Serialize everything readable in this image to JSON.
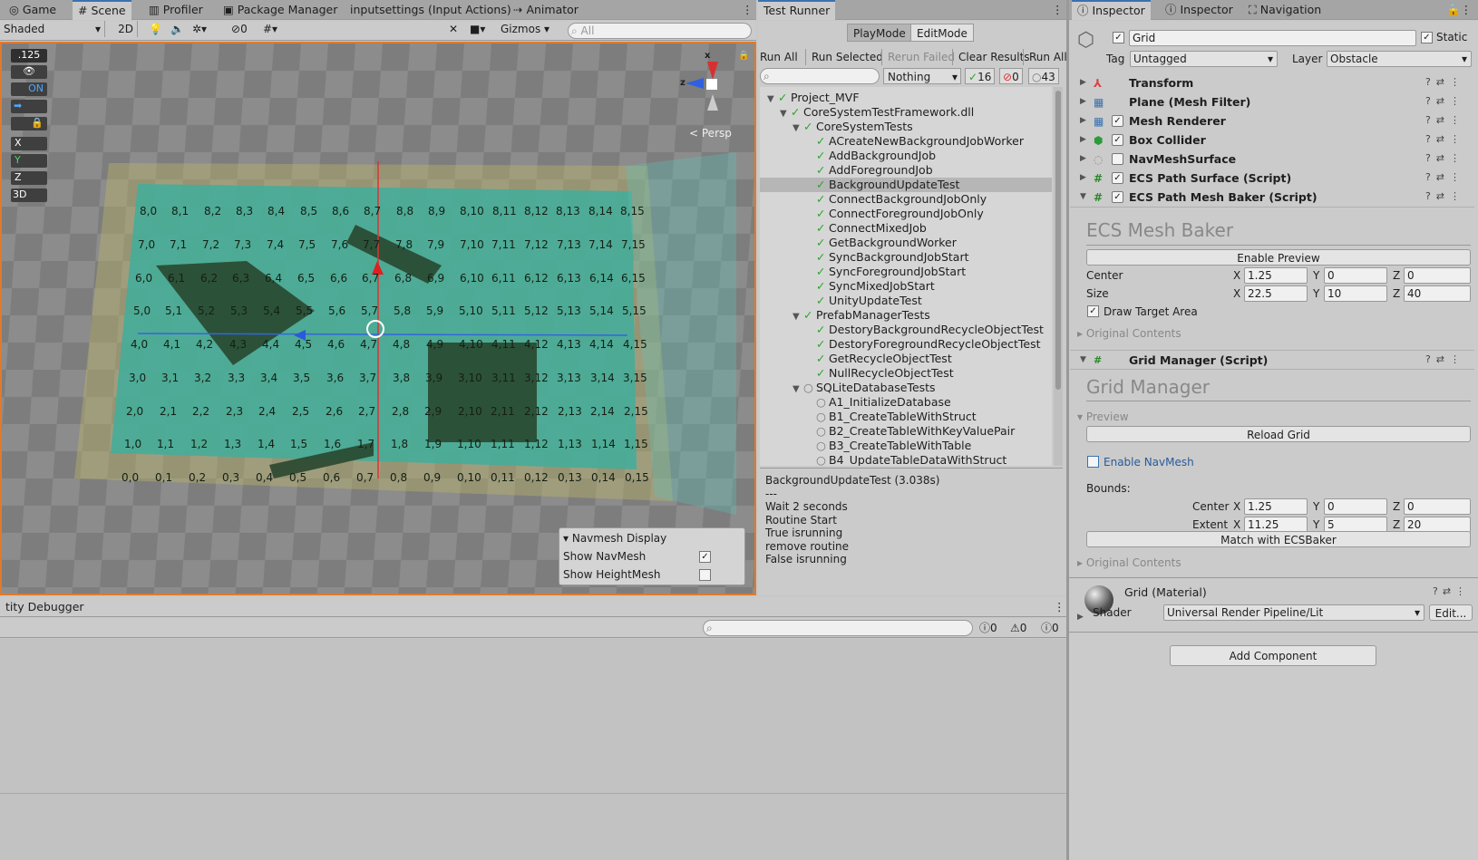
{
  "scene_tabs": {
    "game": "Game",
    "scene": "Scene",
    "profiler": "Profiler",
    "package_manager": "Package Manager",
    "input_settings": "inputsettings (Input Actions)",
    "animator": "Animator"
  },
  "scene_toolbar": {
    "shading": "Shaded",
    "mode_2d": "2D",
    "hidden_count": "0",
    "gizmos": "Gizmos",
    "search_placeholder": "All"
  },
  "scene_overlay": {
    "snap_value": ".125",
    "toggle_on": "ON",
    "axis_x": "X",
    "axis_y": "Y",
    "axis_z": "Z",
    "axis_3d": "3D",
    "persp": "Persp",
    "gizmo_x": "x",
    "gizmo_z": "z"
  },
  "navmesh_display": {
    "title": "Navmesh Display",
    "show_navmesh": "Show NavMesh",
    "show_heightmesh": "Show HeightMesh",
    "show_navmesh_checked": true,
    "show_heightmesh_checked": false
  },
  "grid_labels": [
    [
      "8,0",
      "8,1",
      "8,2",
      "8,3",
      "8,4",
      "8,5",
      "8,6",
      "8,7",
      "8,8",
      "8,9",
      "8,10",
      "8,11",
      "8,12",
      "8,13",
      "8,14",
      "8,15"
    ],
    [
      "7,0",
      "7,1",
      "7,2",
      "7,3",
      "7,4",
      "7,5",
      "7,6",
      "7,7",
      "7,8",
      "7,9",
      "7,10",
      "7,11",
      "7,12",
      "7,13",
      "7,14",
      "7,15"
    ],
    [
      "6,0",
      "6,1",
      "6,2",
      "6,3",
      "6,4",
      "6,5",
      "6,6",
      "6,7",
      "6,8",
      "6,9",
      "6,10",
      "6,11",
      "6,12",
      "6,13",
      "6,14",
      "6,15"
    ],
    [
      "5,0",
      "5,1",
      "5,2",
      "5,3",
      "5,4",
      "5,5",
      "5,6",
      "5,7",
      "5,8",
      "5,9",
      "5,10",
      "5,11",
      "5,12",
      "5,13",
      "5,14",
      "5,15"
    ],
    [
      "4,0",
      "4,1",
      "4,2",
      "4,3",
      "4,4",
      "4,5",
      "4,6",
      "4,7",
      "4,8",
      "4,9",
      "4,10",
      "4,11",
      "4,12",
      "4,13",
      "4,14",
      "4,15"
    ],
    [
      "3,0",
      "3,1",
      "3,2",
      "3,3",
      "3,4",
      "3,5",
      "3,6",
      "3,7",
      "3,8",
      "3,9",
      "3,10",
      "3,11",
      "3,12",
      "3,13",
      "3,14",
      "3,15"
    ],
    [
      "2,0",
      "2,1",
      "2,2",
      "2,3",
      "2,4",
      "2,5",
      "2,6",
      "2,7",
      "2,8",
      "2,9",
      "2,10",
      "2,11",
      "2,12",
      "2,13",
      "2,14",
      "2,15"
    ],
    [
      "1,0",
      "1,1",
      "1,2",
      "1,3",
      "1,4",
      "1,5",
      "1,6",
      "1,7",
      "1,8",
      "1,9",
      "1,10",
      "1,11",
      "1,12",
      "1,13",
      "1,14",
      "1,15"
    ],
    [
      "0,0",
      "0,1",
      "0,2",
      "0,3",
      "0,4",
      "0,5",
      "0,6",
      "0,7",
      "0,8",
      "0,9",
      "0,10",
      "0,11",
      "0,12",
      "0,13",
      "0,14",
      "0,15"
    ]
  ],
  "test_runner": {
    "tab": "Test Runner",
    "playmode": "PlayMode",
    "editmode": "EditMode",
    "run_all": "Run All",
    "run_selected": "Run Selected",
    "rerun_failed": "Rerun Failed",
    "clear_results": "Clear Results",
    "run_all_2": "Run All",
    "filter": "Nothing",
    "passed": "16",
    "failed": "0",
    "not_run": "43",
    "tree": [
      {
        "label": "Project_MVF",
        "depth": 0,
        "status": "pass",
        "expanded": true
      },
      {
        "label": "CoreSystemTestFramework.dll",
        "depth": 1,
        "status": "pass",
        "expanded": true
      },
      {
        "label": "CoreSystemTests",
        "depth": 2,
        "status": "pass",
        "expanded": true
      },
      {
        "label": "ACreateNewBackgroundJobWorker",
        "depth": 3,
        "status": "pass"
      },
      {
        "label": "AddBackgroundJob",
        "depth": 3,
        "status": "pass"
      },
      {
        "label": "AddForegroundJob",
        "depth": 3,
        "status": "pass"
      },
      {
        "label": "BackgroundUpdateTest",
        "depth": 3,
        "status": "pass",
        "selected": true
      },
      {
        "label": "ConnectBackgroundJobOnly",
        "depth": 3,
        "status": "pass"
      },
      {
        "label": "ConnectForegroundJobOnly",
        "depth": 3,
        "status": "pass"
      },
      {
        "label": "ConnectMixedJob",
        "depth": 3,
        "status": "pass"
      },
      {
        "label": "GetBackgroundWorker",
        "depth": 3,
        "status": "pass"
      },
      {
        "label": "SyncBackgroundJobStart",
        "depth": 3,
        "status": "pass"
      },
      {
        "label": "SyncForegroundJobStart",
        "depth": 3,
        "status": "pass"
      },
      {
        "label": "SyncMixedJobStart",
        "depth": 3,
        "status": "pass"
      },
      {
        "label": "UnityUpdateTest",
        "depth": 3,
        "status": "pass"
      },
      {
        "label": "PrefabManagerTests",
        "depth": 2,
        "status": "pass",
        "expanded": true
      },
      {
        "label": "DestoryBackgroundRecycleObjectTest",
        "depth": 3,
        "status": "pass"
      },
      {
        "label": "DestoryForegroundRecycleObjectTest",
        "depth": 3,
        "status": "pass"
      },
      {
        "label": "GetRecycleObjectTest",
        "depth": 3,
        "status": "pass"
      },
      {
        "label": "NullRecycleObjectTest",
        "depth": 3,
        "status": "pass"
      },
      {
        "label": "SQLiteDatabaseTests",
        "depth": 2,
        "status": "none",
        "expanded": true
      },
      {
        "label": "A1_InitializeDatabase",
        "depth": 3,
        "status": "none"
      },
      {
        "label": "B1_CreateTableWithStruct",
        "depth": 3,
        "status": "none"
      },
      {
        "label": "B2_CreateTableWithKeyValuePair",
        "depth": 3,
        "status": "none"
      },
      {
        "label": "B3_CreateTableWithTable",
        "depth": 3,
        "status": "none"
      },
      {
        "label": "B4_UpdateTableDataWithStruct",
        "depth": 3,
        "status": "none"
      }
    ],
    "output": [
      "BackgroundUpdateTest (3.038s)",
      "---",
      "Wait 2 seconds",
      "Routine Start",
      "True isrunning",
      "remove routine",
      "False isrunning"
    ]
  },
  "debugger": {
    "title": "tity Debugger",
    "log_count": "0",
    "warn_count": "0",
    "error_count": "0"
  },
  "inspector": {
    "tabs": {
      "inspector1": "Inspector",
      "inspector2": "Inspector",
      "navigation": "Navigation"
    },
    "object_name": "Grid",
    "static_label": "Static",
    "tag_label": "Tag",
    "tag_value": "Untagged",
    "layer_label": "Layer",
    "layer_value": "Obstacle",
    "components": [
      {
        "name": "Transform",
        "has_check": false,
        "icon": "transform-icon"
      },
      {
        "name": "Plane (Mesh Filter)",
        "has_check": false,
        "icon": "mesh-filter-icon"
      },
      {
        "name": "Mesh Renderer",
        "has_check": true,
        "icon": "mesh-renderer-icon"
      },
      {
        "name": "Box Collider",
        "has_check": true,
        "icon": "box-collider-icon"
      },
      {
        "name": "NavMeshSurface",
        "has_check": true,
        "icon": "navmesh-icon"
      },
      {
        "name": "ECS Path Surface (Script)",
        "has_check": true,
        "icon": "script-icon"
      },
      {
        "name": "ECS Path Mesh Baker (Script)",
        "has_check": true,
        "icon": "script-icon"
      }
    ],
    "mesh_baker": {
      "header": "ECS Mesh Baker",
      "enable_preview": "Enable Preview",
      "center_label": "Center",
      "center": {
        "x": "1.25",
        "y": "0",
        "z": "0"
      },
      "size_label": "Size",
      "size": {
        "x": "22.5",
        "y": "10",
        "z": "40"
      },
      "draw_target": "Draw Target Area",
      "original_contents": "Original Contents"
    },
    "grid_manager": {
      "name": "Grid Manager (Script)",
      "header": "Grid Manager",
      "preview": "Preview",
      "reload": "Reload Grid",
      "enable_navmesh": "Enable NavMesh",
      "bounds": "Bounds:",
      "center_label": "Center",
      "center": {
        "x": "1.25",
        "y": "0",
        "z": "0"
      },
      "extent_label": "Extent",
      "extent": {
        "x": "11.25",
        "y": "5",
        "z": "20"
      },
      "match": "Match with ECSBaker",
      "original_contents": "Original Contents"
    },
    "material": {
      "name": "Grid (Material)",
      "shader_label": "Shader",
      "shader": "Universal Render Pipeline/Lit",
      "edit": "Edit..."
    },
    "add_component": "Add Component",
    "axis": {
      "x": "X",
      "y": "Y",
      "z": "Z"
    }
  }
}
